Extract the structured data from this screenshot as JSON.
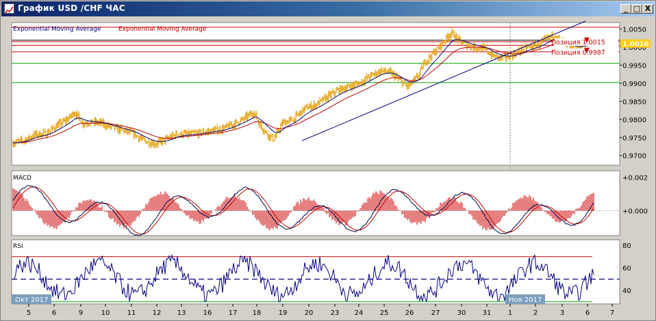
{
  "window": {
    "title": "График USD /CHF ЧАС",
    "buttons": {
      "minimize": "_",
      "maximize": "□",
      "close": "X"
    }
  },
  "legend": {
    "ema1": "Exponential Moving Average",
    "ema2": "Exponential Moving Average"
  },
  "colors": {
    "background": "#ffffff",
    "candles": "#e6a519",
    "ema_fast": "#000080",
    "ema_slow": "#c00000",
    "trendline": "#000080",
    "level_red": "#cc0000",
    "level_green": "#00a000",
    "macd_hist": "#cc0000",
    "rsi_line": "#000080",
    "rsi_high": "#cc00cc",
    "rsi_low": "#00a000",
    "price_tag": "#ffcc00"
  },
  "chart_data": [
    {
      "type": "line",
      "panel": "price",
      "series": [
        {
          "name": "Exponential Moving Average",
          "style": "blue"
        },
        {
          "name": "Exponential Moving Average",
          "style": "red"
        }
      ],
      "yaxis": {
        "ticks": [
          1.005,
          1.0,
          0.995,
          0.99,
          0.985,
          0.98,
          0.975,
          0.97
        ],
        "tick_labels": [
          "1.0050",
          "1.0000",
          "0.9950",
          "0.9900",
          "0.9850",
          "0.9800",
          "0.9750",
          "0.9700"
        ],
        "ylim": [
          0.9673,
          1.0068
        ]
      },
      "current_price": "1.0010",
      "hlines": [
        {
          "value": 1.0055,
          "color": "red"
        },
        {
          "value": 1.0019,
          "color": "black"
        },
        {
          "value": 1.0015,
          "color": "red"
        },
        {
          "value": 1.0005,
          "color": "red"
        },
        {
          "value": 0.9987,
          "color": "red"
        },
        {
          "value": 0.9955,
          "color": "green"
        },
        {
          "value": 0.9902,
          "color": "green"
        }
      ],
      "positions": [
        {
          "label": "Позиция 1.0015",
          "value": 1.0015
        },
        {
          "label": "Позиция 0.9987",
          "value": 0.9987
        }
      ],
      "trendline": {
        "from": {
          "day": 19.6,
          "value": 0.9741
        },
        "to": {
          "day": 6.0,
          "value": 1.0072
        }
      },
      "price_path": [
        [
          0,
          0.9735
        ],
        [
          0.5,
          0.9742
        ],
        [
          1,
          0.9758
        ],
        [
          1.5,
          0.976
        ],
        [
          2,
          0.9782
        ],
        [
          2.5,
          0.98
        ],
        [
          2.8,
          0.982
        ],
        [
          3.2,
          0.979
        ],
        [
          3.6,
          0.9792
        ],
        [
          4,
          0.979
        ],
        [
          4.5,
          0.9778
        ],
        [
          5,
          0.977
        ],
        [
          5.5,
          0.976
        ],
        [
          6,
          0.974
        ],
        [
          6.5,
          0.9732
        ],
        [
          7,
          0.9745
        ],
        [
          7.5,
          0.976
        ],
        [
          8,
          0.9758
        ],
        [
          8.5,
          0.9762
        ],
        [
          9,
          0.9768
        ],
        [
          9.5,
          0.9772
        ],
        [
          10,
          0.9785
        ],
        [
          10.5,
          0.98
        ],
        [
          11,
          0.982
        ],
        [
          11.2,
          0.979
        ],
        [
          11.6,
          0.976
        ],
        [
          11.9,
          0.9745
        ],
        [
          12.3,
          0.979
        ],
        [
          12.8,
          0.98
        ],
        [
          13.3,
          0.983
        ],
        [
          13.8,
          0.984
        ],
        [
          14.3,
          0.986
        ],
        [
          14.8,
          0.988
        ],
        [
          15.3,
          0.989
        ],
        [
          15.8,
          0.99
        ],
        [
          16.3,
          0.992
        ],
        [
          16.8,
          0.9935
        ],
        [
          17.2,
          0.993
        ],
        [
          17.6,
          0.991
        ],
        [
          18,
          0.989
        ],
        [
          18.5,
          0.992
        ],
        [
          18.8,
          0.996
        ],
        [
          19.3,
          0.999
        ],
        [
          19.7,
          1.002
        ],
        [
          20.0,
          1.004
        ],
        [
          20.3,
          1.002
        ],
        [
          20.7,
          1.0005
        ],
        [
          21.1,
          1.0
        ],
        [
          21.5,
          0.9995
        ],
        [
          21.9,
          0.9975
        ],
        [
          22.3,
          0.997
        ],
        [
          22.7,
          0.9975
        ],
        [
          23.1,
          0.9988
        ],
        [
          23.5,
          1.0
        ],
        [
          23.9,
          1.0005
        ],
        [
          24.3,
          1.002
        ],
        [
          24.7,
          1.0035
        ],
        [
          25.0,
          1.0015
        ],
        [
          25.3,
          1.0
        ],
        [
          25.6,
          0.9995
        ],
        [
          25.9,
          1.0
        ],
        [
          26.2,
          1.001
        ],
        [
          26.5,
          1.0015
        ]
      ]
    },
    {
      "type": "line",
      "panel": "MACD",
      "title": "MACD",
      "yaxis": {
        "tick_labels": [
          "+0.002",
          "+0.000"
        ],
        "ticks": [
          0.002,
          0.0
        ],
        "ylim": [
          -0.0015,
          0.0024
        ]
      }
    },
    {
      "type": "line",
      "panel": "RSI",
      "title": "RSI",
      "yaxis": {
        "tick_labels": [
          "80",
          "60",
          "40"
        ],
        "ticks": [
          80,
          60,
          40
        ],
        "ylim": [
          28,
          85
        ]
      },
      "levels": {
        "overbought": 70,
        "oversold": 30,
        "mid": 50
      }
    }
  ],
  "xaxis": {
    "tick_labels": [
      "5",
      "6",
      "9",
      "10",
      "11",
      "12",
      "13",
      "16",
      "17",
      "18",
      "19",
      "20",
      "23",
      "24",
      "25",
      "26",
      "27",
      "30",
      "31",
      "1",
      "2",
      "3",
      "6",
      "7"
    ],
    "month_labels": [
      "Окт 2017",
      "Ноя 2017"
    ]
  }
}
